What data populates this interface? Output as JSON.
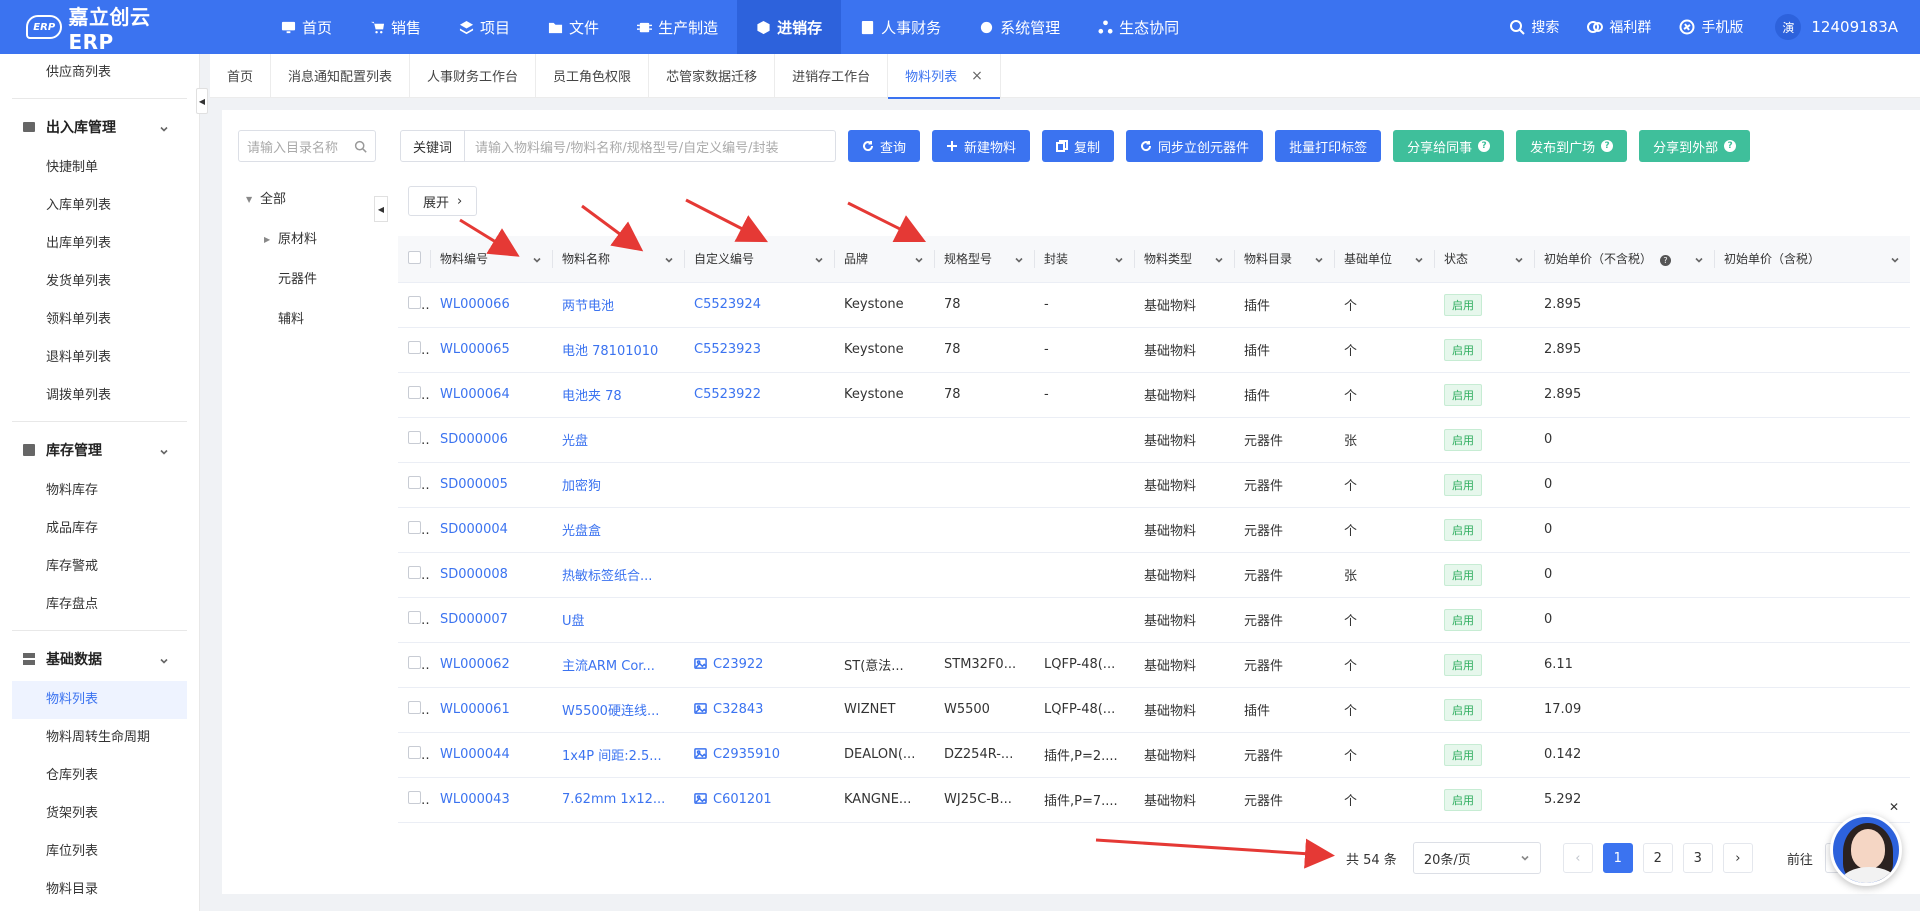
{
  "app": {
    "logo_mark": "ERP",
    "title": "嘉立创云ERP"
  },
  "nav": [
    {
      "label": "首页",
      "icon": "monitor-icon"
    },
    {
      "label": "销售",
      "icon": "cart-icon"
    },
    {
      "label": "项目",
      "icon": "layers-icon"
    },
    {
      "label": "文件",
      "icon": "folder-icon"
    },
    {
      "label": "生产制造",
      "icon": "chip-icon"
    },
    {
      "label": "进销存",
      "icon": "cube-icon",
      "active": true
    },
    {
      "label": "人事财务",
      "icon": "badge-icon"
    },
    {
      "label": "系统管理",
      "icon": "gear-icon"
    },
    {
      "label": "生态协同",
      "icon": "network-icon"
    }
  ],
  "top_right": {
    "search": "搜索",
    "welfare": "福利群",
    "mobile": "手机版",
    "avatar": "演",
    "user": "12409183A"
  },
  "sidebar": {
    "top_item": "供应商列表",
    "groups": [
      {
        "title": "出入库管理",
        "icon": "warehouse-icon",
        "items": [
          "快捷制单",
          "入库单列表",
          "出库单列表",
          "发货单列表",
          "领料单列表",
          "退料单列表",
          "调拨单列表"
        ]
      },
      {
        "title": "库存管理",
        "icon": "inventory-icon",
        "items": [
          "物料库存",
          "成品库存",
          "库存警戒",
          "库存盘点"
        ]
      },
      {
        "title": "基础数据",
        "icon": "database-icon",
        "items": [
          "物料列表",
          "物料周转生命周期",
          "仓库列表",
          "货架列表",
          "库位列表",
          "物料目录"
        ]
      }
    ],
    "active": "物料列表"
  },
  "tabs": [
    "首页",
    "消息通知配置列表",
    "人事财务工作台",
    "员工角色权限",
    "芯管家数据迁移",
    "进销存工作台",
    "物料列表"
  ],
  "tree": {
    "search_placeholder": "请输入目录名称",
    "root": "全部",
    "children": [
      "原材料",
      "元器件",
      "辅料"
    ]
  },
  "filter": {
    "keyword_label": "关键词",
    "keyword_placeholder": "请输入物料编号/物料名称/规格型号/自定义编号/封装",
    "buttons": {
      "query": "查询",
      "new": "新建物料",
      "copy": "复制",
      "sync": "同步立创元器件",
      "print": "批量打印标签",
      "share_colleague": "分享给同事",
      "publish": "发布到广场",
      "share_external": "分享到外部"
    },
    "expand": "展开"
  },
  "table": {
    "columns": [
      "物料编号",
      "物料名称",
      "自定义编号",
      "品牌",
      "规格型号",
      "封装",
      "物料类型",
      "物料目录",
      "基础单位",
      "状态",
      "初始单价（不含税）",
      "初始单价（含税）"
    ],
    "rows": [
      [
        "WL000066",
        "两节电池",
        "C5523924",
        "Keystone",
        "78",
        "-",
        "基础物料",
        "插件",
        "个",
        "启用",
        "2.895",
        "",
        false
      ],
      [
        "WL000065",
        "电池 78101010",
        "C5523923",
        "Keystone",
        "78",
        "-",
        "基础物料",
        "插件",
        "个",
        "启用",
        "2.895",
        "",
        false
      ],
      [
        "WL000064",
        "电池夹 78",
        "C5523922",
        "Keystone",
        "78",
        "-",
        "基础物料",
        "插件",
        "个",
        "启用",
        "2.895",
        "",
        false
      ],
      [
        "SD000006",
        "光盘",
        "",
        "",
        "",
        "",
        "基础物料",
        "元器件",
        "张",
        "启用",
        "0",
        "",
        false
      ],
      [
        "SD000005",
        "加密狗",
        "",
        "",
        "",
        "",
        "基础物料",
        "元器件",
        "个",
        "启用",
        "0",
        "",
        false
      ],
      [
        "SD000004",
        "光盘盒",
        "",
        "",
        "",
        "",
        "基础物料",
        "元器件",
        "个",
        "启用",
        "0",
        "",
        false
      ],
      [
        "SD000008",
        "热敏标签纸合...",
        "",
        "",
        "",
        "",
        "基础物料",
        "元器件",
        "张",
        "启用",
        "0",
        "",
        false
      ],
      [
        "SD000007",
        "U盘",
        "",
        "",
        "",
        "",
        "基础物料",
        "元器件",
        "个",
        "启用",
        "0",
        "",
        false
      ],
      [
        "WL000062",
        "主流ARM Cor...",
        "C23922",
        "ST(意法...",
        "STM32F0...",
        "LQFP-48(...",
        "基础物料",
        "元器件",
        "个",
        "启用",
        "6.11",
        "",
        true
      ],
      [
        "WL000061",
        "W5500硬连线...",
        "C32843",
        "WIZNET",
        "W5500",
        "LQFP-48(...",
        "基础物料",
        "插件",
        "个",
        "启用",
        "17.09",
        "",
        true
      ],
      [
        "WL000044",
        "1x4P 间距:2.5...",
        "C2935910",
        "DEALON(...",
        "DZ254R-...",
        "插件,P=2....",
        "基础物料",
        "元器件",
        "个",
        "启用",
        "0.142",
        "",
        true
      ],
      [
        "WL000043",
        "7.62mm 1x12...",
        "C601201",
        "KANGNE...",
        "WJ25C-B...",
        "插件,P=7....",
        "基础物料",
        "元器件",
        "个",
        "启用",
        "5.292",
        "",
        true
      ]
    ]
  },
  "pager": {
    "total": "共 54 条",
    "page_size": "20条/页",
    "pages": [
      "1",
      "2",
      "3"
    ],
    "current": "1",
    "goto": "前往"
  },
  "colors": {
    "primary": "#3b73f0",
    "green": "#3fbf9b",
    "annotation": "#e53935"
  }
}
